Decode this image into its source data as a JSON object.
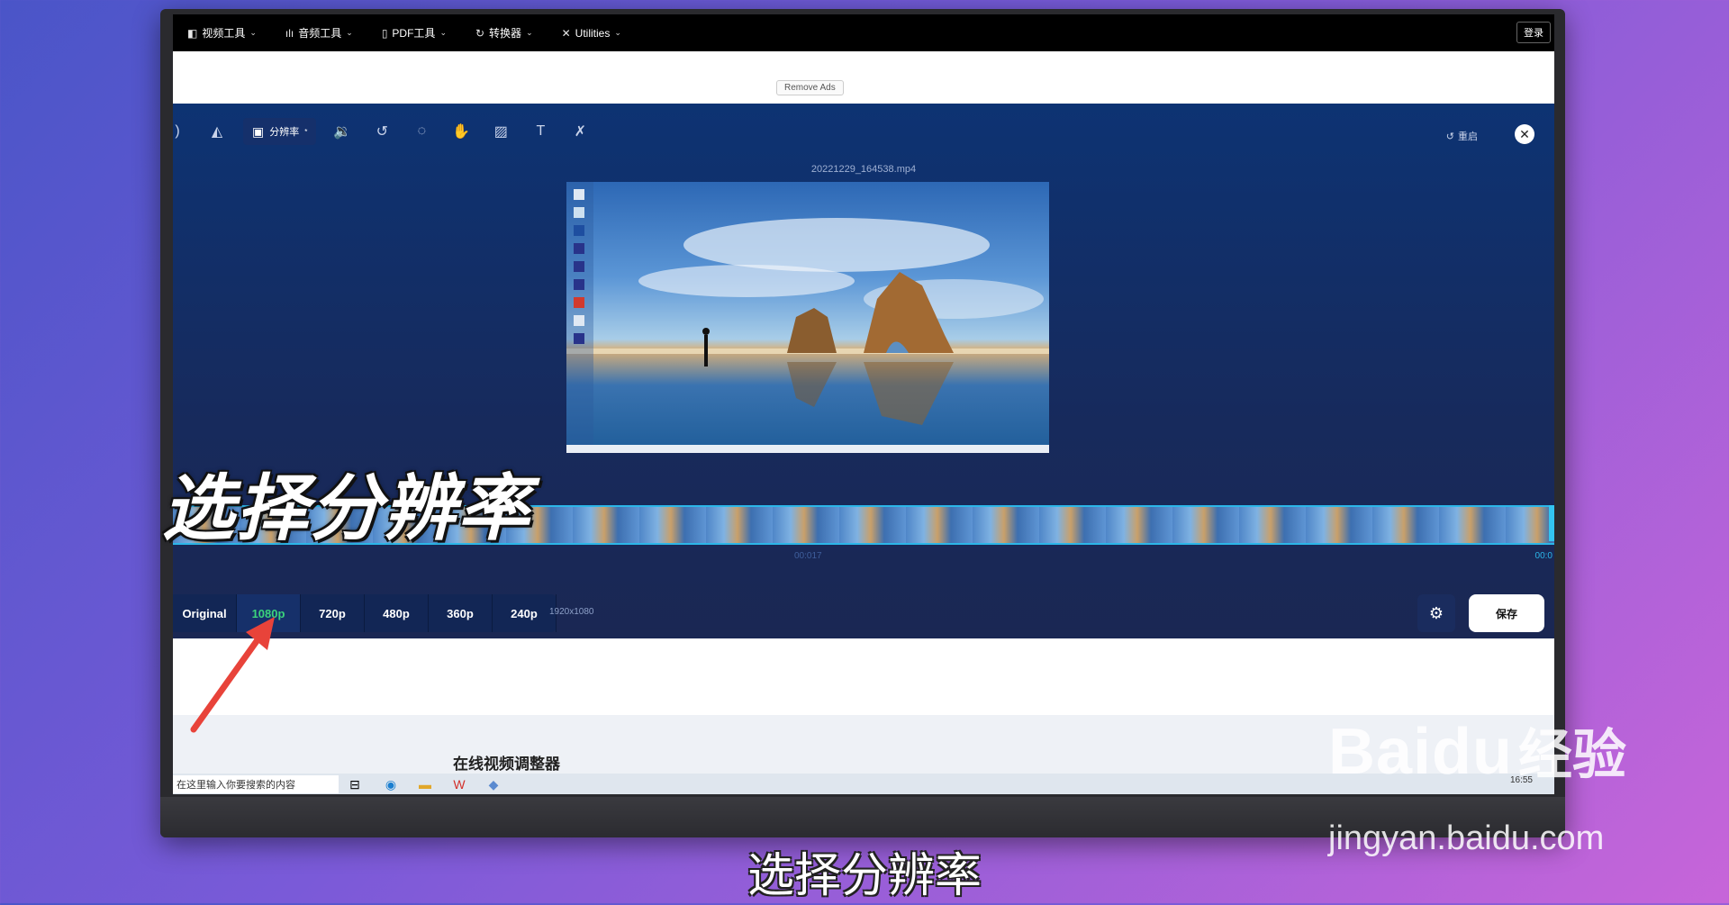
{
  "nav": {
    "items": [
      {
        "icon": "video-icon",
        "label": "视频工具"
      },
      {
        "icon": "audio-icon",
        "label": "音频工具"
      },
      {
        "icon": "pdf-icon",
        "label": "PDF工具"
      },
      {
        "icon": "convert-icon",
        "label": "转换器"
      },
      {
        "icon": "utilities-icon",
        "label": "Utilities"
      }
    ],
    "login": "登录"
  },
  "ads": {
    "remove_label": "Remove Ads"
  },
  "toolbar": {
    "active_tool": "分辨率",
    "reset_label": "重启"
  },
  "video": {
    "filename": "20221229_164538.mp4"
  },
  "timeline": {
    "mid_time": "00:017",
    "end_time": "00:0"
  },
  "resolution": {
    "options": [
      "Original",
      "1080p",
      "720p",
      "480p",
      "360p",
      "240p"
    ],
    "selected": "1080p",
    "info": "1920x1080",
    "save_label": "保存"
  },
  "page": {
    "heading": "在线视频调整器"
  },
  "windows": {
    "search_placeholder": "在这里输入你要搜索的内容",
    "clock": "16:55"
  },
  "overlay": {
    "title": "选择分辨率",
    "caption": "选择分辨率"
  },
  "watermark": {
    "logo": "Baidu",
    "cn": "经验",
    "url": "jingyan.baidu.com"
  }
}
